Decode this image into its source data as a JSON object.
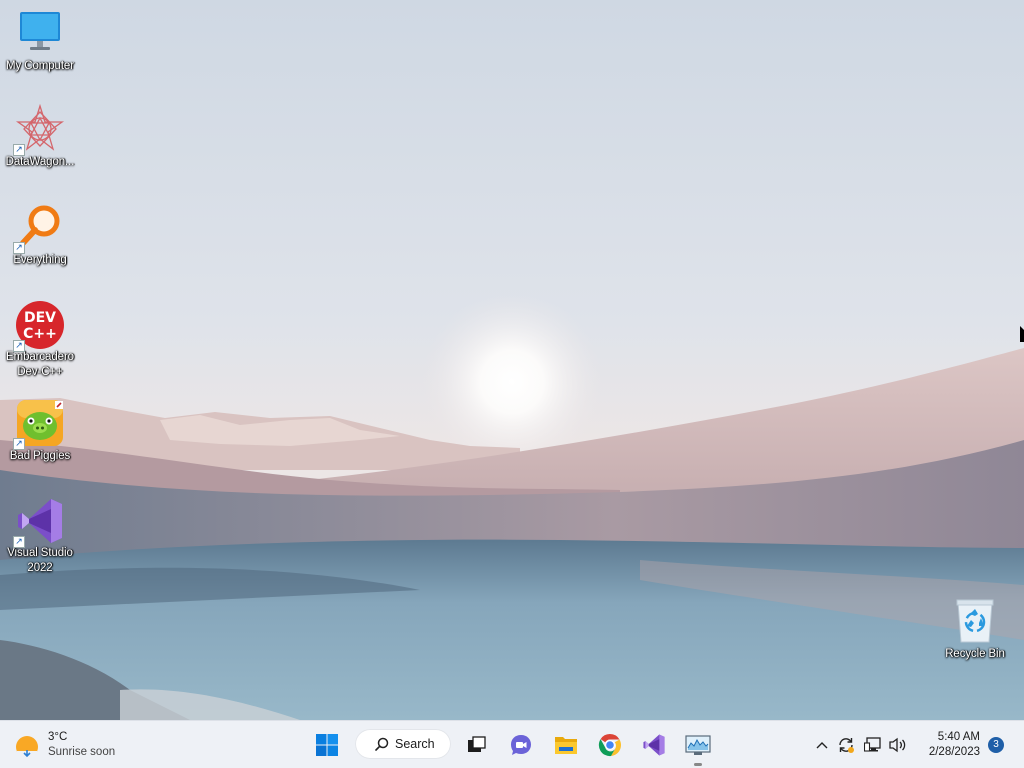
{
  "desktop": {
    "icons": [
      {
        "id": "my-computer",
        "label": "My Computer",
        "shortcut": false
      },
      {
        "id": "datawagon",
        "label": "DataWagon...",
        "shortcut": true
      },
      {
        "id": "everything",
        "label": "Everything",
        "shortcut": true
      },
      {
        "id": "devcpp",
        "label": "Embarcadero Dev-C++",
        "shortcut": true,
        "logo_text_1": "DEV",
        "logo_text_2": "C++"
      },
      {
        "id": "bad-piggies",
        "label": "Bad Piggies",
        "shortcut": true
      },
      {
        "id": "visual-studio",
        "label": "Visual Studio 2022",
        "shortcut": true
      }
    ],
    "recycle_bin": {
      "label": "Recycle Bin"
    }
  },
  "taskbar": {
    "weather": {
      "temp": "3°C",
      "condition": "Sunrise soon",
      "icon": "sun-icon"
    },
    "search": {
      "label": "Search",
      "icon": "search-icon"
    },
    "apps": [
      {
        "name": "start",
        "icon": "windows-logo-icon"
      },
      {
        "name": "task-view",
        "icon": "task-view-icon"
      },
      {
        "name": "teams-chat",
        "icon": "chat-camera-icon"
      },
      {
        "name": "file-explorer",
        "icon": "folder-icon"
      },
      {
        "name": "chrome",
        "icon": "chrome-icon"
      },
      {
        "name": "visual-studio",
        "icon": "visual-studio-icon"
      },
      {
        "name": "performance-monitor",
        "icon": "monitor-chart-icon",
        "active": true
      }
    ],
    "tray": {
      "time": "5:40 AM",
      "date": "2/28/2023",
      "notification_count": "3",
      "icons": [
        "chevron-up-icon",
        "sync-icon",
        "network-icon",
        "volume-icon"
      ]
    }
  },
  "colors": {
    "taskbar_bg": "#eef1f6",
    "win_blue": "#0078d4",
    "notif_badge": "#1f5fa8"
  }
}
